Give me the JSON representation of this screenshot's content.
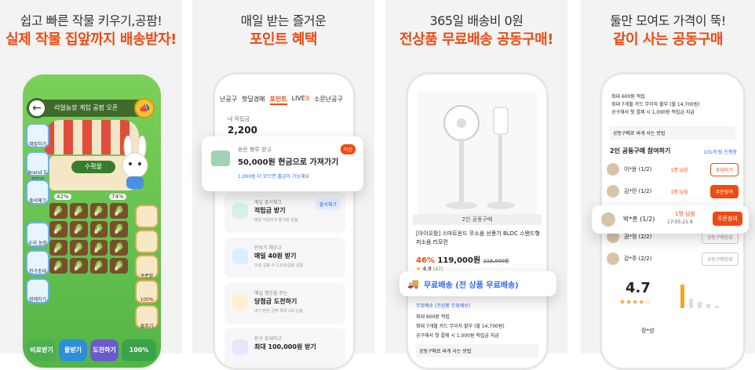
{
  "panels": [
    {
      "caption1": "쉽고 빠른 작물 키우기,공팜!",
      "caption2": "실제 작물 집앞까지 배송받자!"
    },
    {
      "caption1": "매일 받는 즐거운",
      "caption2": "포인트 혜택"
    },
    {
      "caption1": "365일 배송비 0원",
      "caption2": "전상품 무료배송 공동구매!"
    },
    {
      "caption1": "둘만 모여도 가격이 뚝!",
      "caption2": "같이 사는 공동구매"
    }
  ],
  "game": {
    "title": "리얼농장 게임 공팜 오픈",
    "badge": "수확물",
    "pct_left": "42%",
    "pct_right": "74%",
    "left_buttons": [
      "채집하기",
      "Brand 도전미션",
      "출석체크",
      "우리 농장",
      "친구초대",
      "함께하기"
    ],
    "right_buttons": [
      "",
      "",
      "쿠폰함",
      "100%",
      "물주기"
    ],
    "bottom": [
      "비료받기",
      "물받기",
      "도전하기",
      "100%"
    ]
  },
  "points": {
    "tabs": [
      "난공구",
      "핫딜경매",
      "포인트",
      "LIVE",
      "소문난공구"
    ],
    "live_mark": "9",
    "my_label": "내 적립금",
    "my_value": "2,200",
    "popup": {
      "small": "용돈 봉투 받고",
      "title": "50,000원 현금으로 가져가기",
      "sub": "1,000원 더 모으면 출금이 가능해요",
      "badge": "미션"
    },
    "cards": [
      {
        "t1": "매일 출석체크",
        "t2": "적립금 받기",
        "t3": "매일 지급되어 총 5회 남음",
        "btn": "출석체크"
      },
      {
        "t1": "만보기 채우고",
        "t2": "매일 40원 받기",
        "t3": "오늘 걸음 수 2,030걸음 남음",
        "btn": ""
      },
      {
        "t1": "매일 행운을 주는",
        "t2": "당첨금 도전하기",
        "t3": "내가 받은 금액 최대 2회 남음",
        "btn": ""
      },
      {
        "t1": "친구 초대하고",
        "t2": "최대 100,000원 받기",
        "t3": "",
        "btn": ""
      }
    ]
  },
  "shipping": {
    "tag": "2인 공동구매",
    "name": "[아이오팜] 스마트윈드 무소음 선풍기 BLDC 스탠드형 저소음 리모컨",
    "discount": "46%",
    "price": "119,000원",
    "orig": "219,000원",
    "rating": "4.9",
    "reviews": "(47)",
    "popup": "무료배송 (전 상품 무료배송)",
    "ship_line": "무료배송 (전상품 무료배송)",
    "point_line": "최대 600원 적립",
    "card_line": "최대 7개월 카드 무이자 할부 (월 14,700원)",
    "extra": "공구해서 첫 결제 시 1,000원 적립금 지급",
    "how": "공동구매로 싸게 사는 방법"
  },
  "group": {
    "top": [
      "최대 600원 적립",
      "최대 7개월 카드 무이자 할부 (월 14,700원)",
      "공구해서 첫 결제 시 1,000원 적립금 지급"
    ],
    "how": "공동구매로 싸게 사는 방법",
    "header": "2인 공동구매 참여하기",
    "header_link": "101개 팀 진행중",
    "rows": [
      {
        "name": "이*윤 (1/2)",
        "left": "1명 남음",
        "time": "20:05:21.9",
        "btn": "초대하기",
        "full": false
      },
      {
        "name": "김*민 (1/2)",
        "left": "1명 남음",
        "time": "17:05:21.9",
        "btn": "주문참여",
        "full": true
      },
      {
        "name": "박*훈 (1/2)",
        "left": "1명 남음",
        "time": "17:05:21.9",
        "btn": "주문참여",
        "full": true
      },
      {
        "name": "권*정 (2/2)",
        "left": "",
        "time": "",
        "btn": "공동구매완료",
        "full": false
      },
      {
        "name": "강*주 (2/2)",
        "left": "",
        "time": "",
        "btn": "공동구매완료",
        "full": false
      }
    ],
    "rating": "4.7",
    "stars": "★★★★☆",
    "reviewer": "장*성"
  }
}
